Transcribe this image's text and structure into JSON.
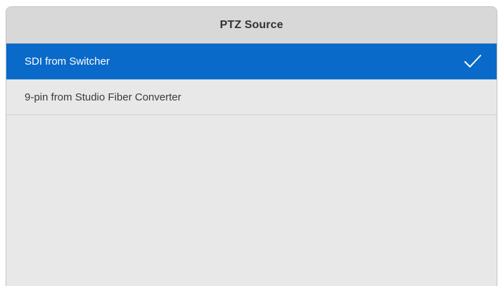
{
  "header": {
    "title": "PTZ Source"
  },
  "options": [
    {
      "label": "SDI from Switcher",
      "selected": true
    },
    {
      "label": "9-pin from Studio Fiber Converter",
      "selected": false
    }
  ],
  "colors": {
    "selected_bg": "#0a6ac9",
    "panel_bg": "#e8e8e8",
    "header_bg": "#d8d8d8"
  },
  "icons": {
    "selected_indicator": "checkmark-icon"
  }
}
